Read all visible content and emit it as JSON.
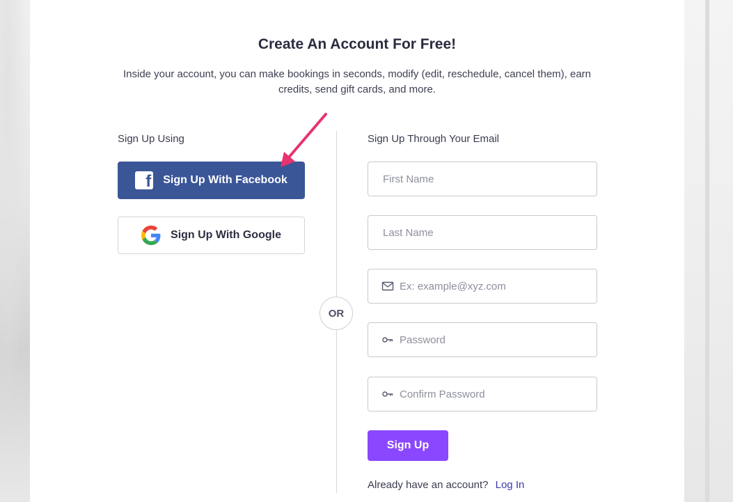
{
  "header": {
    "title": "Create An Account For Free!",
    "subtitle": "Inside your account, you can make bookings in seconds, modify (edit, reschedule, cancel them), earn credits, send gift cards, and more."
  },
  "social": {
    "label": "Sign Up Using",
    "facebook_label": "Sign Up With Facebook",
    "google_label": "Sign Up With Google",
    "facebook_color": "#3b5697"
  },
  "divider": {
    "or_label": "OR"
  },
  "email_form": {
    "label": "Sign Up Through Your Email",
    "first_name_placeholder": "First Name",
    "last_name_placeholder": "Last Name",
    "email_placeholder": "Ex: example@xyz.com",
    "password_placeholder": "Password",
    "confirm_password_placeholder": "Confirm Password",
    "email_icon": "mail-icon",
    "password_icon": "key-icon",
    "submit_label": "Sign Up",
    "submit_color": "#8a47ff"
  },
  "footer": {
    "prompt": "Already have an account?",
    "login_label": "Log In"
  },
  "annotation": {
    "arrow_icon": "pointer-arrow",
    "arrow_color": "#e8336d"
  }
}
